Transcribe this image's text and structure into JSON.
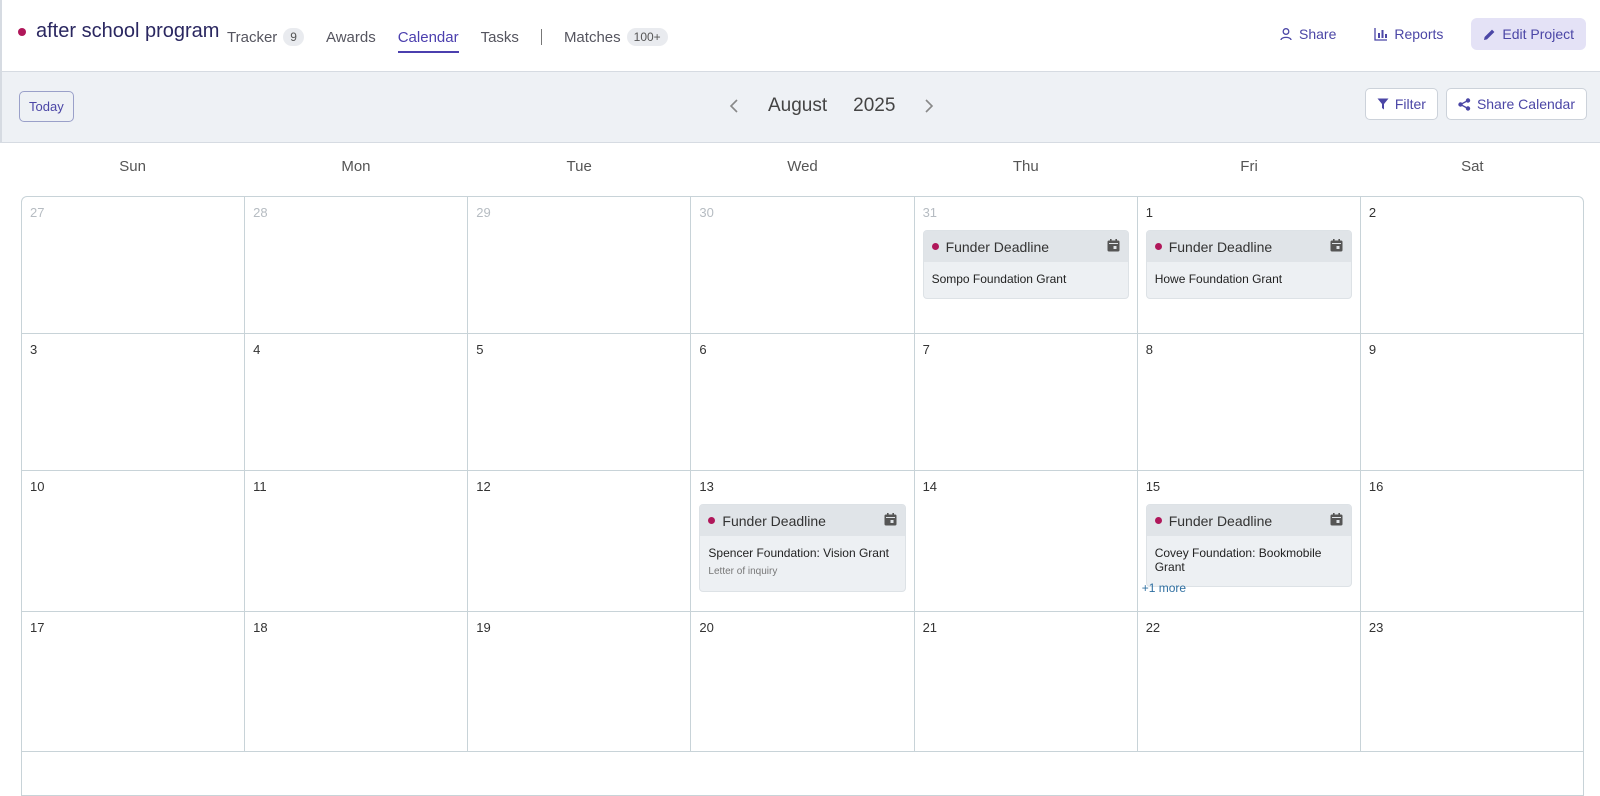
{
  "project": {
    "name": "after school program",
    "accent": "#b0175a"
  },
  "nav": {
    "tracker": "Tracker",
    "tracker_count": "9",
    "awards": "Awards",
    "calendar": "Calendar",
    "tasks": "Tasks",
    "matches": "Matches",
    "matches_count": "100+"
  },
  "actions": {
    "share": "Share",
    "reports": "Reports",
    "edit": "Edit Project"
  },
  "toolbar": {
    "today": "Today",
    "month": "August",
    "year": "2025",
    "filter": "Filter",
    "share_calendar": "Share Calendar"
  },
  "weekdays": [
    "Sun",
    "Mon",
    "Tue",
    "Wed",
    "Thu",
    "Fri",
    "Sat"
  ],
  "weeks": [
    {
      "days": [
        {
          "num": "27",
          "muted": true
        },
        {
          "num": "28",
          "muted": true
        },
        {
          "num": "29",
          "muted": true
        },
        {
          "num": "30",
          "muted": true
        },
        {
          "num": "31",
          "muted": true,
          "event": {
            "type": "Funder Deadline",
            "title": "Sompo Foundation Grant"
          }
        },
        {
          "num": "1",
          "event": {
            "type": "Funder Deadline",
            "title": "Howe Foundation Grant"
          }
        },
        {
          "num": "2"
        }
      ]
    },
    {
      "days": [
        {
          "num": "3"
        },
        {
          "num": "4"
        },
        {
          "num": "5"
        },
        {
          "num": "6"
        },
        {
          "num": "7"
        },
        {
          "num": "8"
        },
        {
          "num": "9"
        }
      ]
    },
    {
      "days": [
        {
          "num": "10"
        },
        {
          "num": "11"
        },
        {
          "num": "12"
        },
        {
          "num": "13",
          "event": {
            "type": "Funder Deadline",
            "title": "Spencer Foundation: Vision Grant",
            "subtitle": "Letter of inquiry"
          }
        },
        {
          "num": "14"
        },
        {
          "num": "15",
          "event": {
            "type": "Funder Deadline",
            "title": "Covey Foundation: Bookmobile Grant"
          },
          "more": "+1 more"
        },
        {
          "num": "16"
        }
      ]
    },
    {
      "days": [
        {
          "num": "17"
        },
        {
          "num": "18"
        },
        {
          "num": "19"
        },
        {
          "num": "20"
        },
        {
          "num": "21"
        },
        {
          "num": "22"
        },
        {
          "num": "23"
        }
      ]
    }
  ]
}
